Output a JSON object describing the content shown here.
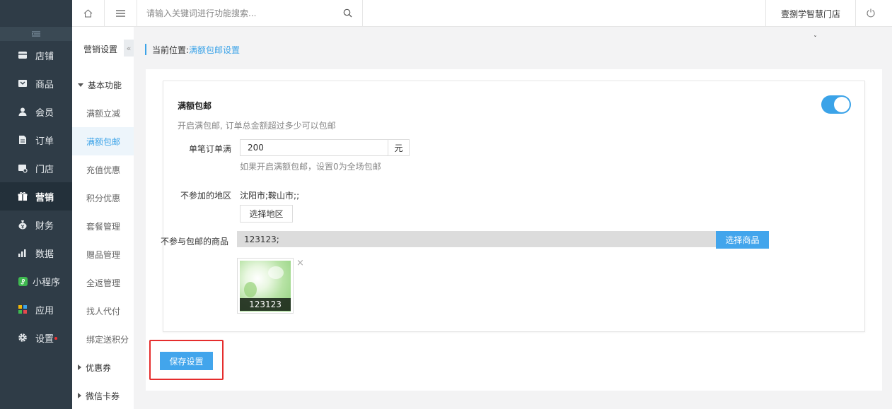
{
  "sidebar": {
    "collapse_icon": "collapse-lines-icon",
    "items": [
      {
        "label": "店铺",
        "icon": "store-icon"
      },
      {
        "label": "商品",
        "icon": "goods-icon"
      },
      {
        "label": "会员",
        "icon": "member-icon"
      },
      {
        "label": "订单",
        "icon": "order-icon"
      },
      {
        "label": "门店",
        "icon": "shop-icon"
      },
      {
        "label": "营销",
        "icon": "gift-icon",
        "active": true
      },
      {
        "label": "财务",
        "icon": "money-bag-icon"
      },
      {
        "label": "数据",
        "icon": "bar-chart-icon"
      },
      {
        "label": "小程序",
        "icon": "miniapp-icon"
      },
      {
        "label": "应用",
        "icon": "apps-icon"
      },
      {
        "label": "设置",
        "icon": "gear-icon",
        "badge": true
      }
    ]
  },
  "submenu": {
    "title": "营销设置",
    "collapse_label": "«",
    "group_basic": "基本功能",
    "items": [
      "满额立减",
      "满额包邮",
      "充值优惠",
      "积分优惠",
      "套餐管理",
      "赠品管理",
      "全返管理",
      "找人代付",
      "绑定送积分"
    ],
    "active_item": "满额包邮",
    "group_coupon": "优惠券",
    "group_wxcard": "微信卡券"
  },
  "topbar": {
    "search_placeholder": "请输入关键词进行功能搜索...",
    "shop_name": "壹捌学智慧门店"
  },
  "breadcrumb": {
    "prefix": "当前位置:",
    "current": "满额包邮设置",
    "caret": "ˇ"
  },
  "form": {
    "title": "满额包邮",
    "description": "开启满包邮, 订单总金额超过多少可以包邮",
    "toggle_on": true,
    "amount_label": "单笔订单满",
    "amount_value": "200",
    "amount_unit": "元",
    "amount_hint": "如果开启满额包邮，设置0为全场包邮",
    "region_label": "不参加的地区",
    "region_value": "沈阳市;鞍山市;;",
    "region_button": "选择地区",
    "goods_label": "不参与包邮的商品",
    "goods_value": "123123;",
    "goods_button": "选择商品",
    "goods_thumb_caption": "123123",
    "goods_thumb_close": "×",
    "save_button": "保存设置"
  },
  "colors": {
    "accent": "#3ba3e8",
    "sidebar_bg": "#2f3c47",
    "highlight_border": "#e52d2d"
  }
}
